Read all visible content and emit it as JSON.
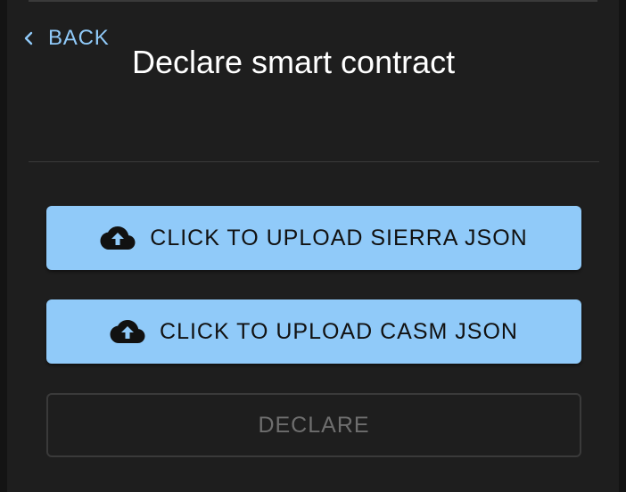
{
  "colors": {
    "background": "#1e1e1e",
    "accent": "#90caf9",
    "disabled_text": "#6e6e6e"
  },
  "nav": {
    "back_label": "BACK",
    "back_icon": "chevron-left-icon"
  },
  "header": {
    "title": "Declare smart contract"
  },
  "actions": {
    "upload_sierra_label": "CLICK TO UPLOAD SIERRA JSON",
    "upload_casm_label": "CLICK TO UPLOAD CASM JSON",
    "upload_icon": "cloud-upload-icon",
    "declare_label": "DECLARE",
    "declare_disabled": true
  }
}
